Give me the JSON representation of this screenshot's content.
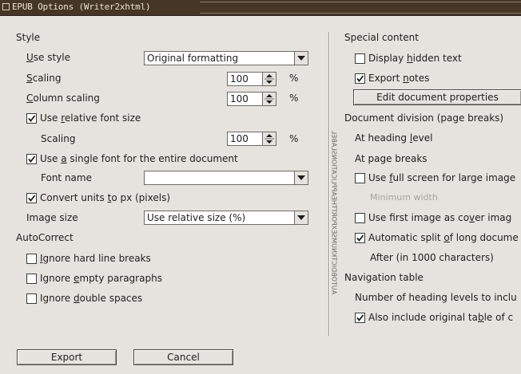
{
  "window": {
    "title": "EPUB Options (Writer2xhtml)"
  },
  "style": {
    "heading": "Style",
    "use_style_label": "Use style",
    "use_style_value": "Original formatting",
    "scaling_label": "Scaling",
    "scaling_value": "100",
    "column_scaling_label": "Column scaling",
    "column_scaling_value": "100",
    "relative_font_label": "Use relative font size",
    "relative_font_checked": true,
    "relative_scaling_label": "Scaling",
    "relative_scaling_value": "100",
    "single_font_label": "Use a single font for the entire document",
    "single_font_checked": true,
    "font_name_label": "Font name",
    "font_name_value": "",
    "convert_units_label": "Convert units to px (pixels)",
    "convert_units_checked": true,
    "image_size_label": "Image size",
    "image_size_value": "Use relative size (%)",
    "percent": "%"
  },
  "autocorrect": {
    "heading": "AutoCorrect",
    "ignore_line_breaks": "Ignore hard line breaks",
    "ignore_empty_paragraphs": "Ignore empty paragraphs",
    "ignore_double_spaces": "Ignore double spaces"
  },
  "special": {
    "heading": "Special content",
    "display_hidden": "Display hidden text",
    "export_notes": "Export notes",
    "export_notes_checked": true,
    "edit_props": "Edit document properties"
  },
  "division": {
    "heading": "Document division (page breaks)",
    "at_heading_level": "At heading level",
    "at_page_breaks": "At page breaks",
    "full_screen": "Use full screen for large image",
    "minimum_width": "Minimum width",
    "first_image_cover": "Use first image as cover imag",
    "auto_split": "Automatic split of long docume",
    "auto_split_checked": true,
    "after_chars": "After (in 1000 characters)"
  },
  "navigation": {
    "heading": "Navigation table",
    "levels": "Number of heading levels to inclu",
    "also_include": "Also include original table of c",
    "also_include_checked": true
  },
  "vertical_text": "AUTOBDICTKNUMSEXPORTTHEAPPLICATIONSLABEL",
  "buttons": {
    "export": "Export",
    "cancel": "Cancel"
  }
}
